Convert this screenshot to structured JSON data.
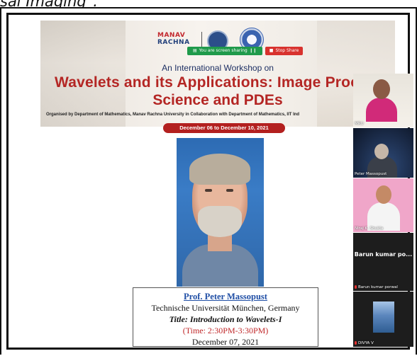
{
  "caption": "sal Imaging\".",
  "banner": {
    "logo_manav_line1": "MANAV",
    "logo_manav_line2": "RACHNA",
    "share_status": "You are screen sharing",
    "stop_share": "Stop Share",
    "intro": "An International Workshop on",
    "title_line1": "Wavelets and its Applications: Image Processing, Da",
    "title_line2": "Science and PDEs",
    "organised": "Organised by Department of Mathematics, Manav Rachna University in Collaboration with Department of Mathematics, IIT Ind",
    "dates": "December 06 to December 10, 2021"
  },
  "speaker": {
    "name": "Prof. Peter Massopust",
    "affiliation": "Technische Universität München, Germany",
    "talk_title": "Title: Introduction to Wavelets-I",
    "time": "(Time: 2:30PM-3:30PM)",
    "date": "December 07, 2021"
  },
  "participants": [
    {
      "label": "MRU"
    },
    {
      "label": "Peter Massopust"
    },
    {
      "label": "Niraj K. Shukla"
    },
    {
      "name_display": "Barun kumar po...",
      "label": "Barun kumar porwal"
    },
    {
      "label": "DIVYA V"
    }
  ]
}
